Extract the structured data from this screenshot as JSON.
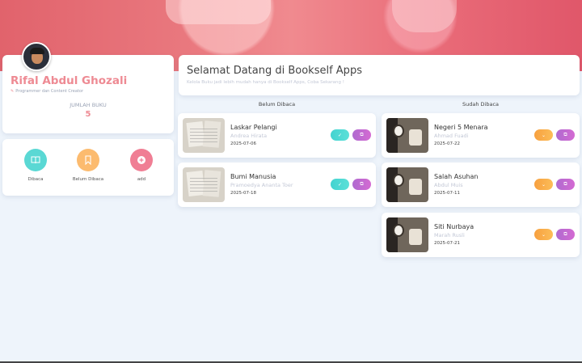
{
  "profile": {
    "name": "Rifal Abdul Ghozali",
    "role": "Programmer dan Content Creator",
    "count_label": "JUMLAH BUKU",
    "count": "5"
  },
  "menu": [
    {
      "label": "Dibaca",
      "icon": "book-open-icon",
      "color": "#5ad8d4"
    },
    {
      "label": "Belum Dibaca",
      "icon": "bookmark-icon",
      "color": "#fcbb6f"
    },
    {
      "label": "add",
      "icon": "plus-circle-icon",
      "color": "#f07e94"
    }
  ],
  "welcome": {
    "title": "Selamat Datang di Bookself Apps",
    "subtitle": "Kelola Buku jadi lebih mudah hanya di Bookself Apps, Coba Sekarang !"
  },
  "columns": {
    "unread": {
      "heading": "Belum Dibaca",
      "books": [
        {
          "title": "Laskar Pelangi",
          "author": "Andrea Hirata",
          "date": "2025-07-06"
        },
        {
          "title": "Bumi Manusia",
          "author": "Pramoedya Ananta Toer",
          "date": "2025-07-18"
        }
      ]
    },
    "read": {
      "heading": "Sudah Dibaca",
      "books": [
        {
          "title": "Negeri 5 Menara",
          "author": "Ahmad Fuadi",
          "date": "2025-07-22"
        },
        {
          "title": "Salah Asuhan",
          "author": "Abdul Muis",
          "date": "2025-07-11"
        },
        {
          "title": "Siti Nurbaya",
          "author": "Marah Rusli",
          "date": "2025-07-21"
        }
      ]
    }
  },
  "colors": {
    "accent_pink": "#ee8a93",
    "teal": "#43d3d0",
    "orange": "#f7a03f",
    "purple": "#b06ad0"
  }
}
